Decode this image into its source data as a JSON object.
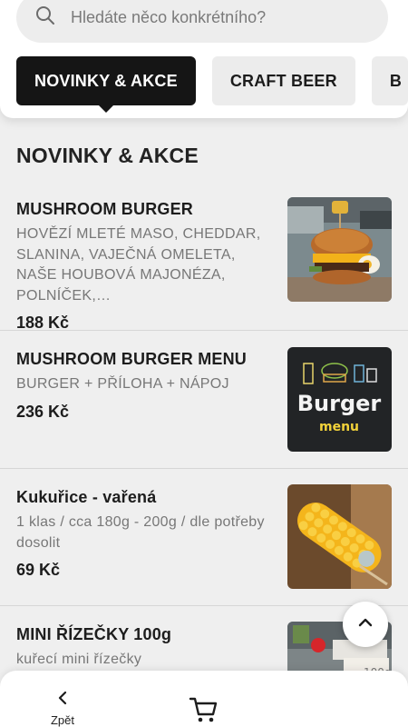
{
  "search": {
    "placeholder": "Hledáte něco konkrétního?",
    "icon": "search-icon"
  },
  "tabs": [
    {
      "label": "NOVINKY & AKCE",
      "active": true
    },
    {
      "label": "CRAFT BEER",
      "active": false
    },
    {
      "label": "B",
      "active": false
    }
  ],
  "section": {
    "title": "NOVINKY & AKCE"
  },
  "items": [
    {
      "name": "MUSHROOM BURGER",
      "description": "HOVĚZÍ MLETÉ MASO, CHEDDAR, SLANINA, VAJEČNÁ OMELETA, NAŠE HOUBOVÁ MAJONÉZA, POLNÍČEK,…",
      "price": "188 Kč",
      "image": "burger-photo"
    },
    {
      "name": "MUSHROOM BURGER MENU",
      "description": "BURGER + PŘÍLOHA + NÁPOJ",
      "price": "236 Kč",
      "image": "burger-menu-chalkboard",
      "image_text": {
        "line1": "Burger",
        "line2": "menu"
      }
    },
    {
      "name": "Kukuřice - vařená",
      "description": "1 klas / cca 180g - 200g / dle potřeby dosolit",
      "price": "69 Kč",
      "image": "corn-photo"
    },
    {
      "name": "MINI ŘÍZEČKY 100g",
      "description": "kuřecí mini řízečky",
      "price": "",
      "image": "schnitzel-photo"
    }
  ],
  "scroll_top": {
    "icon": "chevron-up-icon"
  },
  "bottom_nav": {
    "back_label": "Zpět",
    "back_icon": "chevron-left-icon",
    "cart_icon": "cart-icon"
  }
}
